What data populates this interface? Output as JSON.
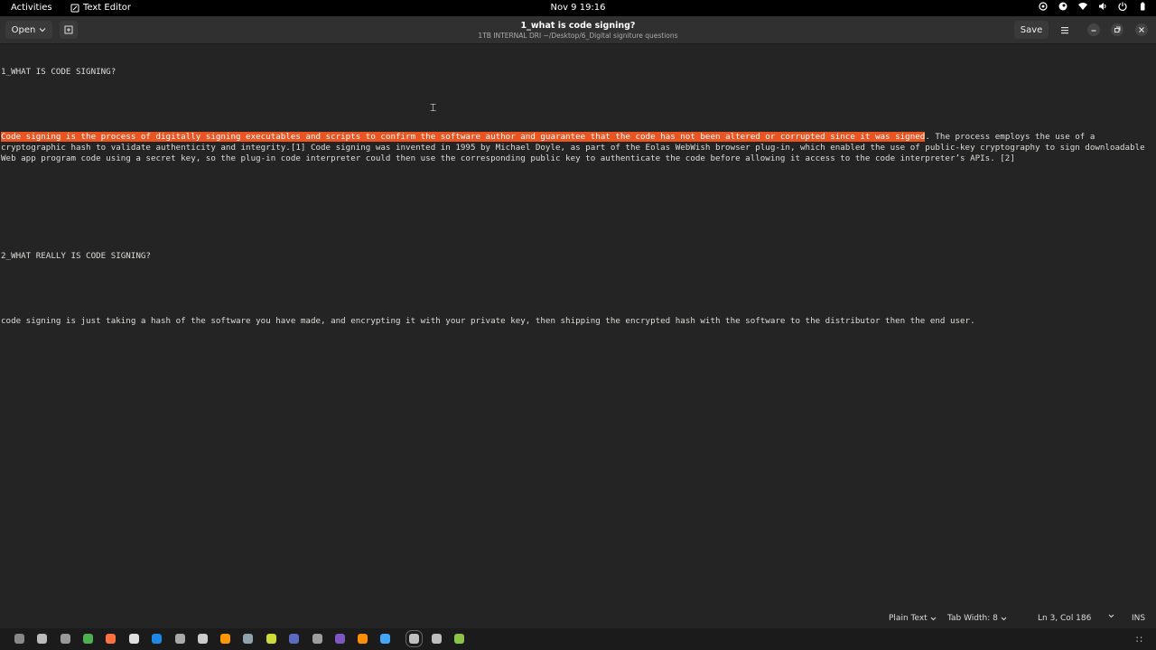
{
  "topbar": {
    "activities": "Activities",
    "app_name": "Text Editor",
    "datetime": "Nov 9  19:16"
  },
  "header": {
    "open_label": "Open",
    "title": "1_what is code signing?",
    "path": "1TB INTERNAL DRI ~/Desktop/6_Digital signiture questions",
    "save_label": "Save"
  },
  "editor": {
    "line1": "1_WHAT IS CODE SIGNING?",
    "line3_selected": "Code signing is the process of digitally signing executables and scripts to confirm the software author and guarantee that the code has not been altered or corrupted since it was signed",
    "line3_rest": ". The process employs the use of a cryptographic hash to validate authenticity and integrity.[1] Code signing was invented in 1995 by Michael Doyle, as part of the Eolas WebWish browser plug-in, which enabled the use of public-key cryptography to sign downloadable Web app program code using a secret key, so the plug-in code interpreter could then use the corresponding public key to authenticate the code before allowing it access to the code interpreter’s APIs. [2]",
    "line6": "2_WHAT REALLY IS CODE SIGNING?",
    "line8": "code signing is just taking a hash of the software you have made, and encrypting it with your private key, then shipping the encrypted hash with the software to the distributor then the end user."
  },
  "statusbar": {
    "language": "Plain Text",
    "tab_width": "Tab Width: 8",
    "position": "Ln 3, Col 186",
    "mode": "INS"
  },
  "colors": {
    "selection": "#e95420",
    "background": "#242424",
    "headerbar": "#303030"
  },
  "dock": {
    "icons": [
      "terminal-icon",
      "files-icon",
      "folder-icon",
      "chrome-icon",
      "firefox-icon",
      "app-icon",
      "steam-icon",
      "app-icon",
      "app-icon",
      "vlc-icon",
      "app-icon",
      "app-icon",
      "app-icon",
      "app-icon",
      "chat-icon",
      "app-icon",
      "app-icon",
      "text-editor-icon",
      "app-icon",
      "app-icon"
    ]
  }
}
